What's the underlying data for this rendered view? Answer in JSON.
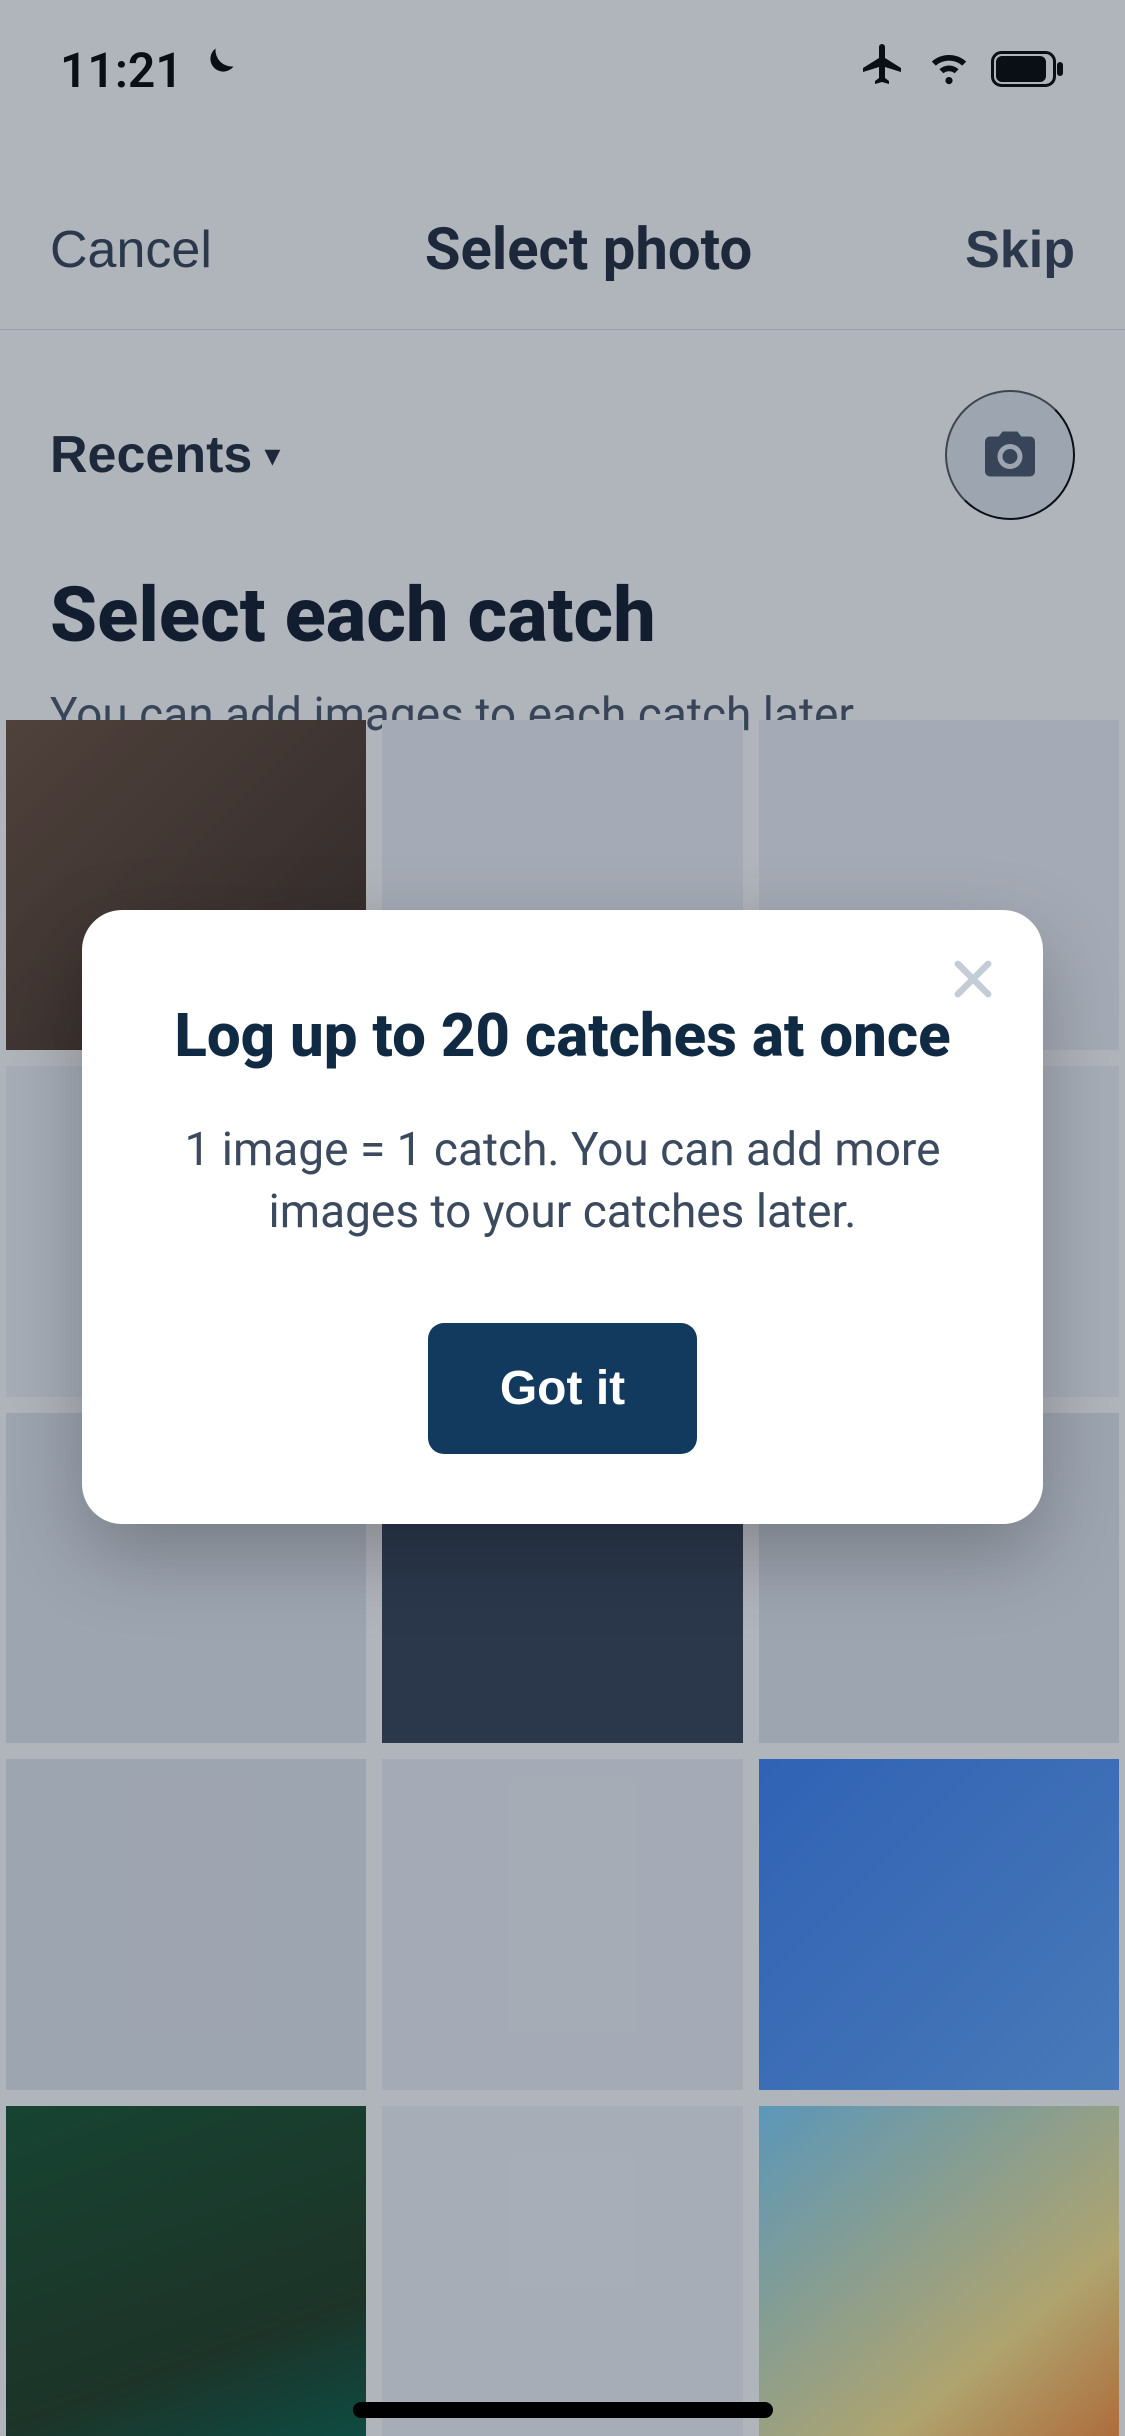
{
  "status": {
    "time": "11:21"
  },
  "nav": {
    "cancel": "Cancel",
    "title": "Select photo",
    "skip": "Skip"
  },
  "section": {
    "album": "Recents",
    "title": "Select each catch",
    "subtitle": "You can add images to each catch later."
  },
  "modal": {
    "title": "Log up to 20 catches at once",
    "body": "1 image = 1 catch. You can add more images to your catches later.",
    "cta": "Got it"
  },
  "colors": {
    "accent": "#123a5e"
  }
}
